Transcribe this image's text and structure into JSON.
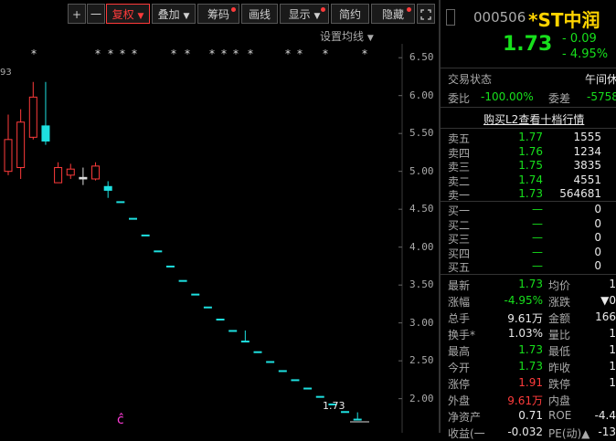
{
  "toolbar": {
    "plus": "+",
    "minus": "一",
    "fuquan": "复权",
    "diejia": "叠加",
    "chouma": "筹码",
    "huaxian": "画线",
    "xianshi": "显示",
    "jianyue": "简约",
    "yincang": "隐藏",
    "expand_icon": "expand-icon"
  },
  "settings_ma": "设置均线",
  "left_partial": "93",
  "price_axis": [
    "6.50",
    "6.00",
    "5.50",
    "5.00",
    "4.50",
    "4.00",
    "3.50",
    "3.00",
    "2.50",
    "2.00"
  ],
  "last_label": "1.73",
  "marker_glyph": "ĉ",
  "quote": {
    "code": "000506",
    "name": "*ST中润",
    "price": "1.73",
    "change": "- 0.09",
    "change_pct": "- 4.95%",
    "trade_status_label": "交易状态",
    "trade_status_value": "午间休",
    "weibi_label": "委比",
    "weibi_value": "-100.00%",
    "weicha_label": "委差",
    "weicha_value": "-5758",
    "l2_link": "购买L2查看十档行情"
  },
  "sell_orders": [
    {
      "label": "卖五",
      "price": "1.77",
      "vol": "1555"
    },
    {
      "label": "卖四",
      "price": "1.76",
      "vol": "1234"
    },
    {
      "label": "卖三",
      "price": "1.75",
      "vol": "3835"
    },
    {
      "label": "卖二",
      "price": "1.74",
      "vol": "4551"
    },
    {
      "label": "卖一",
      "price": "1.73",
      "vol": "564681"
    }
  ],
  "buy_orders": [
    {
      "label": "买一",
      "price": "—",
      "vol": "0"
    },
    {
      "label": "买二",
      "price": "—",
      "vol": "0"
    },
    {
      "label": "买三",
      "price": "—",
      "vol": "0"
    },
    {
      "label": "买四",
      "price": "—",
      "vol": "0"
    },
    {
      "label": "买五",
      "price": "—",
      "vol": "0"
    }
  ],
  "stats": [
    {
      "l1": "最新",
      "v1": "1.73",
      "c1": "green",
      "l2": "均价",
      "v2": "1"
    },
    {
      "l1": "涨幅",
      "v1": "-4.95%",
      "c1": "green",
      "l2": "涨跌",
      "v2": "▼0"
    },
    {
      "l1": "总手",
      "v1": "9.61万",
      "c1": "white",
      "l2": "金额",
      "v2": "166"
    },
    {
      "l1": "换手*",
      "v1": "1.03%",
      "c1": "white",
      "l2": "量比",
      "v2": "1"
    },
    {
      "l1": "最高",
      "v1": "1.73",
      "c1": "green",
      "l2": "最低",
      "v2": "1"
    },
    {
      "l1": "今开",
      "v1": "1.73",
      "c1": "green",
      "l2": "昨收",
      "v2": "1"
    },
    {
      "l1": "涨停",
      "v1": "1.91",
      "c1": "red",
      "l2": "跌停",
      "v2": "1"
    },
    {
      "l1": "外盘",
      "v1": "9.61万",
      "c1": "red",
      "l2": "内盘",
      "v2": ""
    },
    {
      "l1": "净资产",
      "v1": "0.71",
      "c1": "white",
      "l2": "ROE",
      "v2": "-4.4"
    },
    {
      "l1": "收益(一",
      "v1": "-0.032",
      "c1": "white",
      "l2": "PE(动)▲",
      "v2": "-13"
    }
  ],
  "chart_data": {
    "type": "candlestick",
    "ylim": [
      1.7,
      6.7
    ],
    "candles": [
      {
        "open": 5.0,
        "close": 5.42,
        "high": 5.75,
        "low": 4.95,
        "dir": "up"
      },
      {
        "open": 5.05,
        "close": 5.65,
        "high": 5.82,
        "low": 4.9,
        "dir": "up"
      },
      {
        "open": 5.45,
        "close": 5.98,
        "high": 6.18,
        "low": 5.42,
        "dir": "up"
      },
      {
        "open": 5.6,
        "close": 5.4,
        "high": 6.18,
        "low": 5.35,
        "dir": "down"
      },
      {
        "open": 4.85,
        "close": 5.05,
        "high": 5.12,
        "low": 4.85,
        "dir": "up"
      },
      {
        "open": 4.95,
        "close": 5.03,
        "high": 5.1,
        "low": 4.9,
        "dir": "up"
      },
      {
        "open": 4.9,
        "close": 4.92,
        "high": 5.05,
        "low": 4.82,
        "dir": "flat"
      },
      {
        "open": 4.9,
        "close": 5.07,
        "high": 5.12,
        "low": 4.88,
        "dir": "up"
      },
      {
        "open": 4.8,
        "close": 4.75,
        "high": 4.87,
        "low": 4.65,
        "dir": "down"
      },
      {
        "open": 4.6,
        "close": 4.6,
        "high": 4.6,
        "low": 4.6,
        "dir": "flat"
      },
      {
        "open": 4.38,
        "close": 4.38,
        "high": 4.38,
        "low": 4.38,
        "dir": "flat"
      },
      {
        "open": 4.16,
        "close": 4.16,
        "high": 4.16,
        "low": 4.16,
        "dir": "flat"
      },
      {
        "open": 3.95,
        "close": 3.95,
        "high": 3.95,
        "low": 3.95,
        "dir": "flat"
      },
      {
        "open": 3.75,
        "close": 3.75,
        "high": 3.75,
        "low": 3.75,
        "dir": "flat"
      },
      {
        "open": 3.56,
        "close": 3.56,
        "high": 3.56,
        "low": 3.56,
        "dir": "flat"
      },
      {
        "open": 3.38,
        "close": 3.38,
        "high": 3.38,
        "low": 3.38,
        "dir": "flat"
      },
      {
        "open": 3.21,
        "close": 3.21,
        "high": 3.21,
        "low": 3.21,
        "dir": "flat"
      },
      {
        "open": 3.05,
        "close": 3.05,
        "high": 3.05,
        "low": 3.05,
        "dir": "flat"
      },
      {
        "open": 2.9,
        "close": 2.9,
        "high": 2.9,
        "low": 2.9,
        "dir": "flat"
      },
      {
        "open": 2.76,
        "close": 2.76,
        "high": 2.9,
        "low": 2.76,
        "dir": "flat"
      },
      {
        "open": 2.62,
        "close": 2.62,
        "high": 2.62,
        "low": 2.62,
        "dir": "flat"
      },
      {
        "open": 2.49,
        "close": 2.49,
        "high": 2.49,
        "low": 2.49,
        "dir": "flat"
      },
      {
        "open": 2.37,
        "close": 2.37,
        "high": 2.37,
        "low": 2.37,
        "dir": "flat"
      },
      {
        "open": 2.25,
        "close": 2.25,
        "high": 2.25,
        "low": 2.25,
        "dir": "flat"
      },
      {
        "open": 2.14,
        "close": 2.14,
        "high": 2.14,
        "low": 2.14,
        "dir": "flat"
      },
      {
        "open": 2.03,
        "close": 2.03,
        "high": 2.03,
        "low": 2.03,
        "dir": "flat"
      },
      {
        "open": 1.93,
        "close": 1.93,
        "high": 1.93,
        "low": 1.93,
        "dir": "flat"
      },
      {
        "open": 1.83,
        "close": 1.83,
        "high": 1.83,
        "low": 1.83,
        "dir": "flat"
      },
      {
        "open": 1.73,
        "close": 1.73,
        "high": 1.82,
        "low": 1.73,
        "dir": "flat"
      }
    ]
  }
}
